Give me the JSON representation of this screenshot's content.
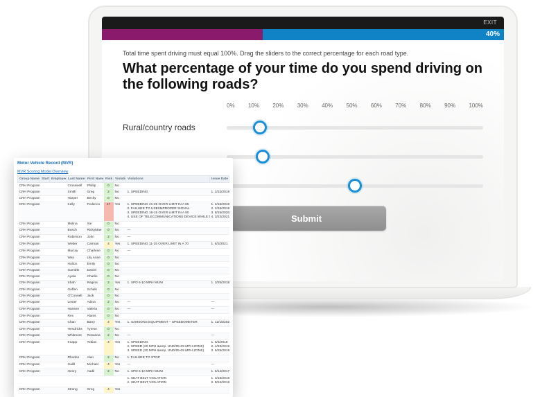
{
  "screen": {
    "exit": "EXIT",
    "progress_pct": "40%",
    "progress_value": 40,
    "instruction": "Total time spent driving must equal 100%. Drag the sliders to the correct percentage for each road type.",
    "question": "What percentage of your time do you spend driving on the following roads?",
    "scale_ticks": [
      "0%",
      "10%",
      "20%",
      "30%",
      "40%",
      "50%",
      "60%",
      "70%",
      "80%",
      "90%",
      "100%"
    ],
    "sliders": [
      {
        "label": "Rural/country roads",
        "value": 13
      },
      {
        "label": "",
        "value": 14
      },
      {
        "label": "",
        "value": 50
      }
    ],
    "submit": "Submit"
  },
  "mvr": {
    "title": "Motor Vehicle Record (MVR)",
    "link": "MVR Scoring Model Overview",
    "columns": [
      "Group Name",
      "Start Date",
      "Employee ID",
      "Last Name",
      "First Name",
      "Risk Score",
      "Violation Multi...",
      "Violations",
      "Issue Date"
    ],
    "rows": [
      {
        "grp": "CRH Program",
        "start": "",
        "emp": "",
        "last": "Crosswell",
        "first": "Phillip",
        "risk": 0,
        "multi": "No",
        "viol": "",
        "date": ""
      },
      {
        "grp": "CRH Program",
        "start": "",
        "emp": "",
        "last": "Smith",
        "first": "Greg",
        "risk": 2,
        "multi": "No",
        "viol": "1. SPEEDING",
        "date": "1. 2/22/2019"
      },
      {
        "grp": "CRH Program",
        "start": "",
        "emp": "",
        "last": "Harper",
        "first": "Becky",
        "risk": 0,
        "multi": "No",
        "viol": "",
        "date": ""
      },
      {
        "grp": "CRH Program",
        "start": "",
        "emp": "",
        "last": "Kelly",
        "first": "Federico",
        "risk": 17,
        "multi": "Yes",
        "viol": "1. SPEEDING 21-25 OVER LIMIT IN A 65\n2. FAILURE TO USE/IMPROPER SIGNAL\n3. SPEEDING 16-15 OVER LIMIT IN A 50\n4. USE OF TELECOMMUNICATIONS DEVICE WHILE DRIVING",
        "date": "1. 2/15/2019\n2. 2/15/2019\n3. 8/15/2020\n4. 3/22/2021"
      },
      {
        "grp": "CRH Program",
        "start": "",
        "emp": "",
        "last": "Molina",
        "first": "Xie",
        "risk": 0,
        "multi": "No",
        "viol": "",
        "date": ""
      },
      {
        "grp": "CRH Program",
        "start": "",
        "emp": "",
        "last": "Busch",
        "first": "RickyMae",
        "risk": 0,
        "multi": "No",
        "viol": "—",
        "date": ""
      },
      {
        "grp": "CRH Program",
        "start": "",
        "emp": "",
        "last": "Robinson",
        "first": "John",
        "risk": 2,
        "multi": "No",
        "viol": "—",
        "date": ""
      },
      {
        "grp": "CRH Program",
        "start": "",
        "emp": "",
        "last": "Weber",
        "first": "Carman",
        "risk": 4,
        "multi": "Yes",
        "viol": "1. SPEEDING 11-15 OVER LIMIT IN A 70",
        "date": "1. 8/3/2021"
      },
      {
        "grp": "CRH Program",
        "start": "",
        "emp": "",
        "last": "Murray",
        "first": "Charlene",
        "risk": 0,
        "multi": "No",
        "viol": "—",
        "date": ""
      },
      {
        "grp": "CRH Program",
        "start": "",
        "emp": "",
        "last": "Wax",
        "first": "Lily Anne",
        "risk": 0,
        "multi": "No",
        "viol": "",
        "date": ""
      },
      {
        "grp": "CRH Program",
        "start": "",
        "emp": "",
        "last": "Holton",
        "first": "Emily",
        "risk": 0,
        "multi": "No",
        "viol": "",
        "date": ""
      },
      {
        "grp": "CRH Program",
        "start": "",
        "emp": "",
        "last": "Gamble",
        "first": "Daniel",
        "risk": 0,
        "multi": "No",
        "viol": "",
        "date": ""
      },
      {
        "grp": "CRH Program",
        "start": "",
        "emp": "",
        "last": "Ayala",
        "first": "Charlie",
        "risk": 0,
        "multi": "No",
        "viol": "",
        "date": ""
      },
      {
        "grp": "CRH Program",
        "start": "",
        "emp": "",
        "last": "Shah",
        "first": "Regina",
        "risk": 2,
        "multi": "Yes",
        "viol": "1. SPD 6-10 MPH MUNI",
        "date": "1. 3/25/2018"
      },
      {
        "grp": "CRH Program",
        "start": "",
        "emp": "",
        "last": "Geffen",
        "first": "Schalk",
        "risk": 0,
        "multi": "No",
        "viol": "",
        "date": ""
      },
      {
        "grp": "CRH Program",
        "start": "",
        "emp": "",
        "last": "O'Connell",
        "first": "Jack",
        "risk": 0,
        "multi": "No",
        "viol": "",
        "date": ""
      },
      {
        "grp": "CRH Program",
        "start": "",
        "emp": "",
        "last": "Lester",
        "first": "Adina",
        "risk": 2,
        "multi": "No",
        "viol": "—",
        "date": "—"
      },
      {
        "grp": "CRH Program",
        "start": "",
        "emp": "",
        "last": "Hansen",
        "first": "Valeria",
        "risk": 0,
        "multi": "No",
        "viol": "—",
        "date": "—"
      },
      {
        "grp": "CRH Program",
        "start": "",
        "emp": "",
        "last": "Rex",
        "first": "Alanis",
        "risk": 0,
        "multi": "No",
        "viol": "",
        "date": ""
      },
      {
        "grp": "CRH Program",
        "start": "",
        "emp": "",
        "last": "Chan",
        "first": "Barry",
        "risk": 4,
        "multi": "Yes",
        "viol": "1. SAMSONS EQUIPMENT – SPEEDOMETER",
        "date": "1. 12/15/2021"
      },
      {
        "grp": "CRH Program",
        "start": "",
        "emp": "",
        "last": "Hendricks",
        "first": "Tyrese",
        "risk": 0,
        "multi": "No",
        "viol": "",
        "date": ""
      },
      {
        "grp": "CRH Program",
        "start": "",
        "emp": "",
        "last": "Whitmore",
        "first": "Rosanna",
        "risk": 2,
        "multi": "No",
        "viol": "—",
        "date": "—"
      },
      {
        "grp": "CRH Program",
        "start": "",
        "emp": "",
        "last": "Knapp",
        "first": "Tobias",
        "risk": 4,
        "multi": "Yes",
        "viol": "1. SPEEDING\n2. SPEED (20 MPH &amp. UND/05-09 MPH ZONE)\n3. SPEED (20 MPH &amp. UND/05-09 MPH ZONE)",
        "date": "1. 6/3/2018\n2. 4/23/2019\n3. 5/25/2019"
      },
      {
        "grp": "CRH Program",
        "start": "",
        "emp": "",
        "last": "Rhodes",
        "first": "Alan",
        "risk": 2,
        "multi": "No",
        "viol": "1. FAILURE TO STOP",
        "date": ""
      },
      {
        "grp": "CRH Program",
        "start": "",
        "emp": "",
        "last": "Galill",
        "first": "Michael",
        "risk": 4,
        "multi": "Yes",
        "viol": "—",
        "date": "—"
      },
      {
        "grp": "CRH Program",
        "start": "",
        "emp": "",
        "last": "Henry",
        "first": "Aadil",
        "risk": 2,
        "multi": "No",
        "viol": "1. SPD 6-10 MPH MUNI",
        "date": "1. 6/14/2017"
      },
      {
        "grp": "",
        "start": "",
        "emp": "",
        "last": "",
        "first": "",
        "risk": "",
        "multi": "",
        "viol": "1. SEAT BELT VIOLATION\n2. SEAT BELT VIOLATION",
        "date": "1. 3/18/2018\n2. 8/24/2018"
      },
      {
        "grp": "CRH Program",
        "start": "",
        "emp": "",
        "last": "Strong",
        "first": "Greg",
        "risk": 4,
        "multi": "Yes",
        "viol": "",
        "date": ""
      }
    ]
  }
}
